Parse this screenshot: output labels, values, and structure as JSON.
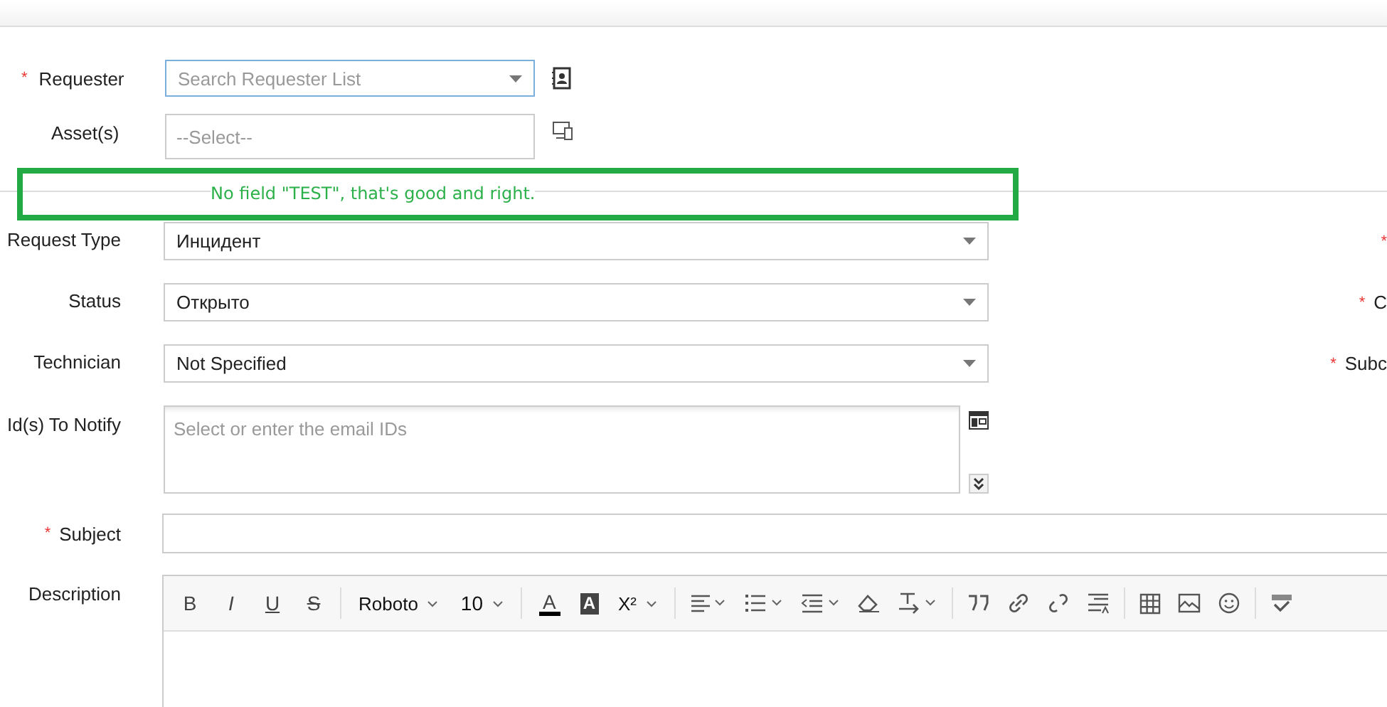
{
  "requester": {
    "label": "Requester",
    "required_mark": "*",
    "placeholder": "Search Requester List"
  },
  "assets": {
    "label": "Asset(s)",
    "placeholder": "--Select--"
  },
  "annotation": {
    "text": "No field \"TEST\", that's good and right."
  },
  "fields": [
    {
      "label": "Request Type",
      "value": "Инцидент",
      "right_required_mark": "*"
    },
    {
      "label": "Status",
      "value": "Открыто",
      "right_required_mark": "*",
      "right_label": "C"
    },
    {
      "label": "Technician",
      "value": "Not Specified",
      "right_required_mark": "*",
      "right_label": "Subc"
    }
  ],
  "notify": {
    "label": "Id(s) To Notify",
    "placeholder": "Select or enter the email IDs"
  },
  "subject": {
    "label": "Subject",
    "required_mark": "*"
  },
  "description": {
    "label": "Description",
    "toolbar": {
      "bold": "B",
      "italic": "I",
      "underline": "U",
      "strike": "S",
      "font": "Roboto",
      "size": "10",
      "font_color": "A",
      "highlight": "A",
      "superscript": "X²"
    }
  }
}
